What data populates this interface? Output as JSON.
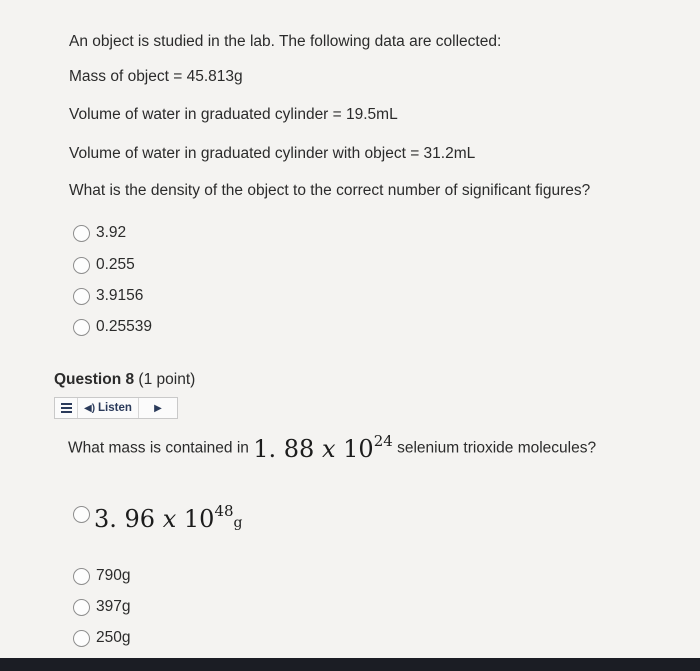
{
  "intro": {
    "statement": "An object is studied in the lab. The following data are collected:",
    "mass": "Mass of object = 45.813g",
    "volume_water": "Volume of water in graduated cylinder = 19.5mL",
    "volume_with_object": "Volume of water in graduated cylinder with object = 31.2mL",
    "question": "What is the density of the object to the correct number of significant figures?"
  },
  "q7_options": [
    "3.92",
    "0.255",
    "3.9156",
    "0.25539"
  ],
  "q8": {
    "title_bold": "Question 8",
    "title_points": "(1 point)",
    "listen_label": "Listen",
    "question_prefix": "What mass is contained in",
    "question_mantissa": "1. 88",
    "question_times": "x",
    "question_base": "10",
    "question_exponent": "24",
    "question_suffix": "selenium trioxide molecules?",
    "option_big": {
      "mantissa": "3. 96",
      "times": "x",
      "base": "10",
      "exponent": "48",
      "unit": "g"
    },
    "options": [
      "790g",
      "397g",
      "250g"
    ]
  },
  "colors": {
    "background": "#f4f3f1",
    "text": "#2b2b2b",
    "listen_text": "#2a3a5a"
  },
  "icons": [
    "menu-icon",
    "speaker-icon",
    "play-icon"
  ]
}
